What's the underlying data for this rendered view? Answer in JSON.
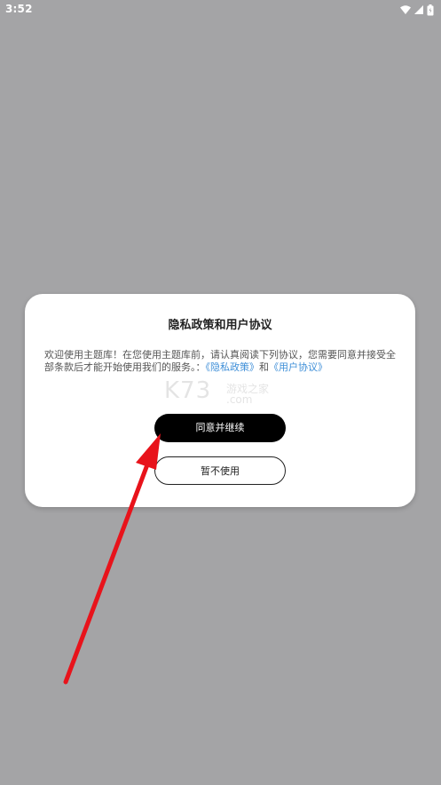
{
  "status_bar": {
    "time": "3:52",
    "icons": [
      "wifi-icon",
      "cell-signal-icon",
      "battery-icon"
    ]
  },
  "dialog": {
    "title": "隐私政策和用户协议",
    "body_prefix": "欢迎使用主题库！在您使用主题库前，请认真阅读下列协议，您需要同意并接受全部条款后才能开始使用我们的服务。：",
    "privacy_link": "《隐私政策》",
    "conjunction": "和",
    "terms_link": "《用户协议》",
    "agree_button": "同意并继续",
    "decline_button": "暂不使用"
  },
  "watermark": {
    "brand": "K73",
    "cn": "游戏之家",
    "domain": ".com"
  },
  "colors": {
    "backdrop": "#a4a4a6",
    "dialog": "#ffffff",
    "link": "#3f8fd8",
    "primary_button": "#000000",
    "arrow": "#e8131b"
  }
}
